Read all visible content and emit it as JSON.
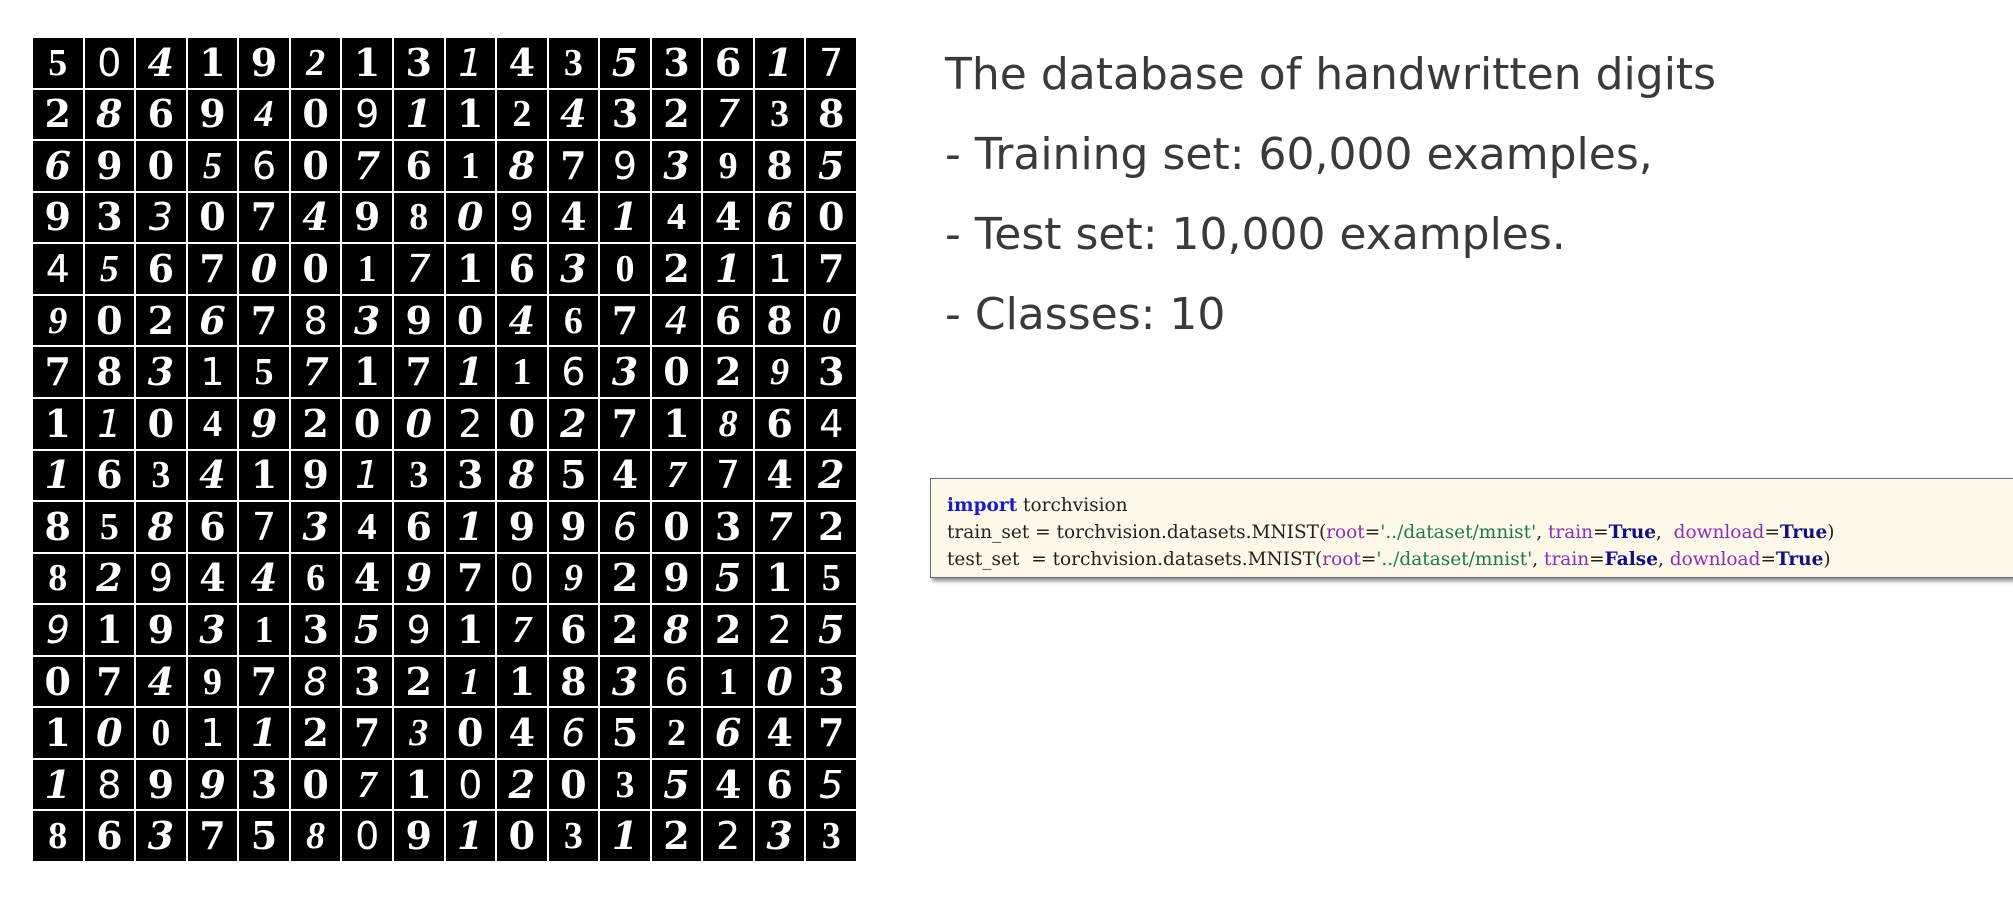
{
  "colors": {
    "text": "#3a3a3a",
    "code_bg": "#fdf8e7",
    "code_keyword": "#1c1cc4",
    "code_argument": "#8a2fb8",
    "code_string": "#1e7a4e"
  },
  "digit_grid": {
    "rows": [
      "5041921314353617",
      "2869409112432738",
      "6905607618793985",
      "9330749809414460",
      "4567001716302117",
      "9026783904674680",
      "7831571711630293",
      "1104920020271864",
      "1634191338547742",
      "8586734619960372",
      "8294464970929515",
      "9193135917628225",
      "0749783211836103",
      "1001127304652647",
      "1899307102035465",
      "8637580910312233"
    ]
  },
  "text_panel": {
    "title": "The database of handwritten digits",
    "training": "- Training set: 60,000 examples,",
    "test": "- Test set: 10,000 examples.",
    "classes": "- Classes: 10"
  },
  "code": {
    "line1": {
      "import_kw": "import",
      "module": " torchvision"
    },
    "line2": {
      "prefix": "train_set = torchvision.datasets.MNIST(",
      "root_arg": "root",
      "eq1": "=",
      "root_val": "'../dataset/mnist'",
      "sep1": ", ",
      "train_arg": "train",
      "eq2": "=",
      "train_val": "True",
      "sep2": ",  ",
      "download_arg": "download",
      "eq3": "=",
      "download_val": "True",
      "suffix": ")"
    },
    "line3": {
      "prefix": "test_set  = torchvision.datasets.MNIST(",
      "root_arg": "root",
      "eq1": "=",
      "root_val": "'../dataset/mnist'",
      "sep1": ", ",
      "train_arg": "train",
      "eq2": "=",
      "train_val": "False",
      "sep2": ", ",
      "download_arg": "download",
      "eq3": "=",
      "download_val": "True",
      "suffix": ")"
    }
  }
}
